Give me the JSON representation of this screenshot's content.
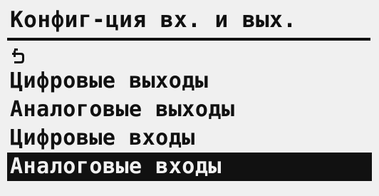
{
  "screen": {
    "title": "Конфиг-ция вх. и вых.",
    "back_icon": "back-arrow-icon",
    "items": [
      {
        "label": "Цифровые выходы",
        "selected": false
      },
      {
        "label": "Аналоговые выходы",
        "selected": false
      },
      {
        "label": "Цифровые входы",
        "selected": false
      },
      {
        "label": "Аналоговые входы",
        "selected": true
      }
    ]
  }
}
